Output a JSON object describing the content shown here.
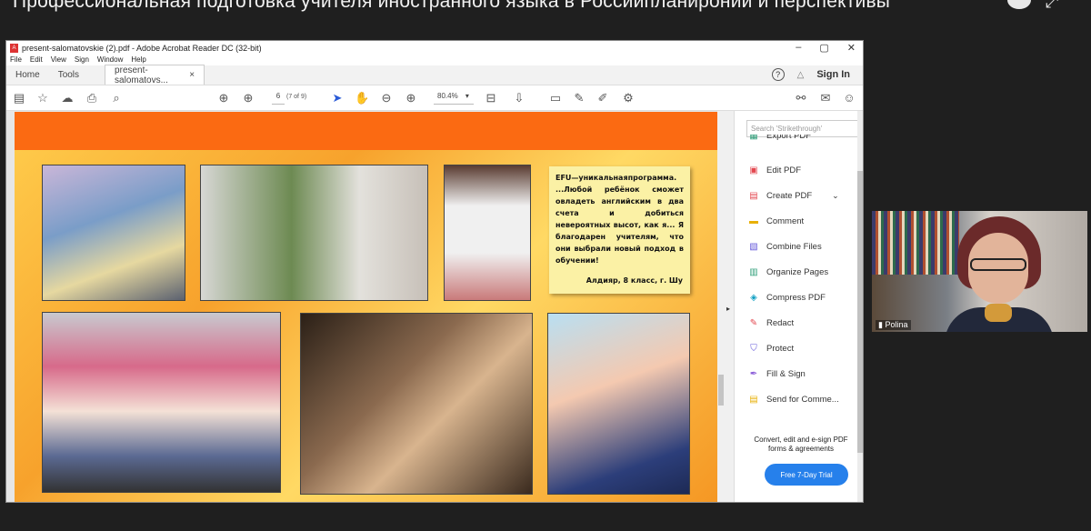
{
  "meeting": {
    "title": "Профессиональная подготовка учителя иностранного языка в Россиипланиронии и перспективы"
  },
  "window": {
    "title": "present-salomatovskie (2).pdf - Adobe Acrobat Reader DC (32-bit)",
    "minimize": "–",
    "maximize": "▢",
    "close": "✕"
  },
  "menu": [
    "File",
    "Edit",
    "View",
    "Sign",
    "Window",
    "Help"
  ],
  "tabs": {
    "home": "Home",
    "tools": "Tools",
    "doc": "present-salomatovs...",
    "doc_close": "×",
    "help": "?",
    "bell": "🔔",
    "sign_in": "Sign In"
  },
  "toolbar": {
    "page_current": "6",
    "page_of": "(7 of 9)",
    "zoom": "80.4%",
    "zoom_caret": "▾"
  },
  "slide": {
    "quote_text": "EFU—уникальнаяпрограмма. ...Любой ребёнок сможет овладеть английским в два счета и добиться невероятных высот, как я... Я благодарен учителям, что они выбрали новый подход в обучении!",
    "quote_signature": "Алдияр, 8 класс, г. Шу"
  },
  "tools_pane": {
    "search_placeholder": "Search 'Strikethrough'",
    "items": [
      {
        "label": "Export PDF",
        "icon": "export-pdf-icon",
        "color": "#2d9d78"
      },
      {
        "label": "Edit PDF",
        "icon": "edit-pdf-icon",
        "color": "#e34850"
      },
      {
        "label": "Create PDF",
        "icon": "create-pdf-icon",
        "color": "#e34850"
      },
      {
        "label": "Comment",
        "icon": "comment-icon",
        "color": "#e8b008"
      },
      {
        "label": "Combine Files",
        "icon": "combine-files-icon",
        "color": "#6154d8"
      },
      {
        "label": "Organize Pages",
        "icon": "organize-pages-icon",
        "color": "#2d9d78"
      },
      {
        "label": "Compress PDF",
        "icon": "compress-pdf-icon",
        "color": "#12a0c3"
      },
      {
        "label": "Redact",
        "icon": "redact-icon",
        "color": "#e34850"
      },
      {
        "label": "Protect",
        "icon": "protect-icon",
        "color": "#6154d8"
      },
      {
        "label": "Fill & Sign",
        "icon": "fill-sign-icon",
        "color": "#8a5cd8"
      },
      {
        "label": "Send for Comme...",
        "icon": "send-for-comment-icon",
        "color": "#e8b008"
      }
    ],
    "promo": "Convert, edit and e-sign PDF forms & agreements",
    "trial_button": "Free 7-Day Trial"
  },
  "video": {
    "participant_name": "Polina"
  }
}
